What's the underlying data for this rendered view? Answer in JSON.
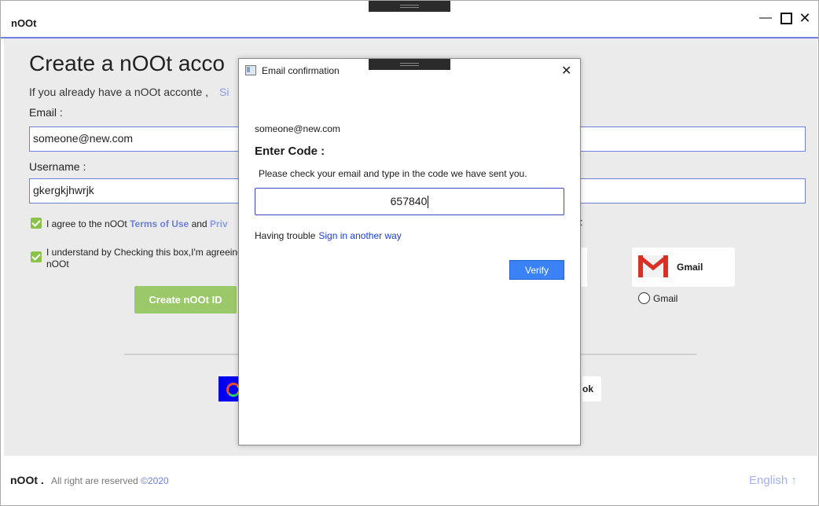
{
  "window": {
    "title": "nOOt"
  },
  "form": {
    "heading": "Create a nOOt acco",
    "have_account_text": "If you already have a nOOt acconte ,",
    "sign_in_link": "Si",
    "email_label": "Email :",
    "email_value": "someone@new.com",
    "username_label": "Username :",
    "username_value": "gkergkjhwrjk",
    "agree_prefix": "I agree to the nOOt",
    "terms_link": "Terms of Use",
    "agree_and": "and",
    "privacy_link": "Priv",
    "understand_text": "I understand by Checking this box,I'm agreeing",
    "understand_text_2": "nOOt",
    "create_button": "Create nOOt ID",
    "colon_tail": ":",
    "gmail_card_label": "Gmail",
    "gmail_radio_label": "Gmail",
    "facebook_partial": "ok"
  },
  "footer": {
    "brand": "nOOt .",
    "rights": "All right are reserved",
    "year": "©2020",
    "language": "English"
  },
  "dialog": {
    "title": "Email confirmation",
    "email": "someone@new.com",
    "enter_code_label": "Enter Code :",
    "instruction": "Please check your email and  type in the code we have sent you.",
    "code_value": "657840",
    "trouble_text": "Having trouble",
    "alt_signin_link": "Sign in another way",
    "verify_button": "Verify"
  },
  "colors": {
    "accent": "#6f7fe0",
    "create_button": "#9bc96a",
    "verify_button": "#3b82f6",
    "link": "#1a3dd6",
    "gmail_red": "#d93025"
  }
}
